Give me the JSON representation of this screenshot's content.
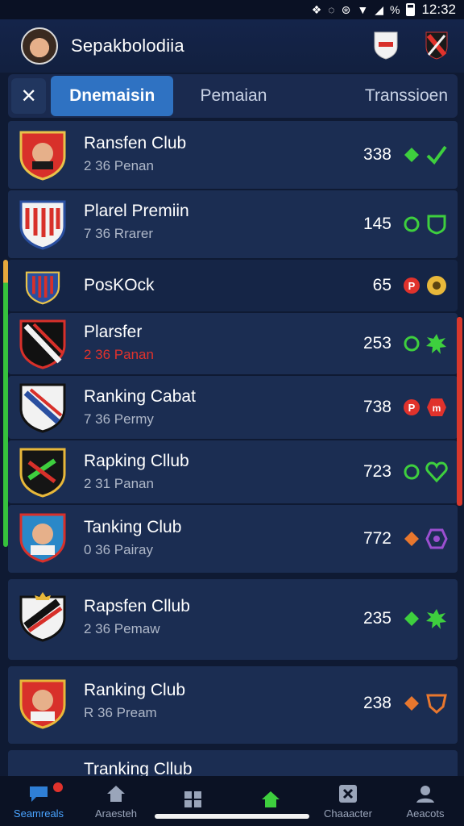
{
  "status_bar": {
    "battery": "%",
    "time": "12:32"
  },
  "header": {
    "title": "Sepakbolodiia"
  },
  "tabs": [
    {
      "label": "Dnemaisin",
      "active": true
    },
    {
      "label": "Pemaian",
      "active": false
    },
    {
      "label": "Transsioen",
      "active": false
    }
  ],
  "list": [
    {
      "name": "Ransfen Club",
      "sub": "2 36 Penan",
      "value": "338",
      "sub_color": "gray"
    },
    {
      "name": "Plarel Premiin",
      "sub": "7 36 Rrarer",
      "value": "145",
      "sub_color": "gray"
    },
    {
      "name": "PosKOck",
      "sub": "",
      "value": "65",
      "sub_color": "gray"
    },
    {
      "name": "Plarsfer",
      "sub": "2 36 Panan",
      "value": "253",
      "sub_color": "red"
    },
    {
      "name": "Ranking Cabat",
      "sub": "7 36 Permy",
      "value": "738",
      "sub_color": "gray"
    },
    {
      "name": "Rapking Cllub",
      "sub": "2 31 Panan",
      "value": "723",
      "sub_color": "gray"
    },
    {
      "name": "Tanking Club",
      "sub": "0 36 Pairay",
      "value": "772",
      "sub_color": "gray"
    },
    {
      "name": "Rapsfen Cllub",
      "sub": "2 36 Pemaw",
      "value": "235",
      "sub_color": "gray"
    },
    {
      "name": "Ranking Club",
      "sub": "R 36 Pream",
      "value": "238",
      "sub_color": "gray"
    },
    {
      "name": "Tranking Cllub",
      "sub": "",
      "value": "",
      "sub_color": "gray"
    }
  ],
  "bottom_nav": [
    {
      "label": "Seamreals",
      "icon": "chat-bubble-icon",
      "active": true
    },
    {
      "label": "Araesteh",
      "icon": "home-icon",
      "active": false
    },
    {
      "label": "",
      "icon": "grid-icon",
      "active": false
    },
    {
      "label": "",
      "icon": "home-green-icon",
      "active": false
    },
    {
      "label": "Chaaacter",
      "icon": "close-box-icon",
      "active": false
    },
    {
      "label": "Aeacots",
      "icon": "profile-icon",
      "active": false
    }
  ],
  "colors": {
    "accent": "#2f72c2",
    "background": "#0f1a33",
    "row": "#1b2d52",
    "green": "#3ecf3e",
    "red": "#e0322c",
    "orange": "#e8772e"
  }
}
